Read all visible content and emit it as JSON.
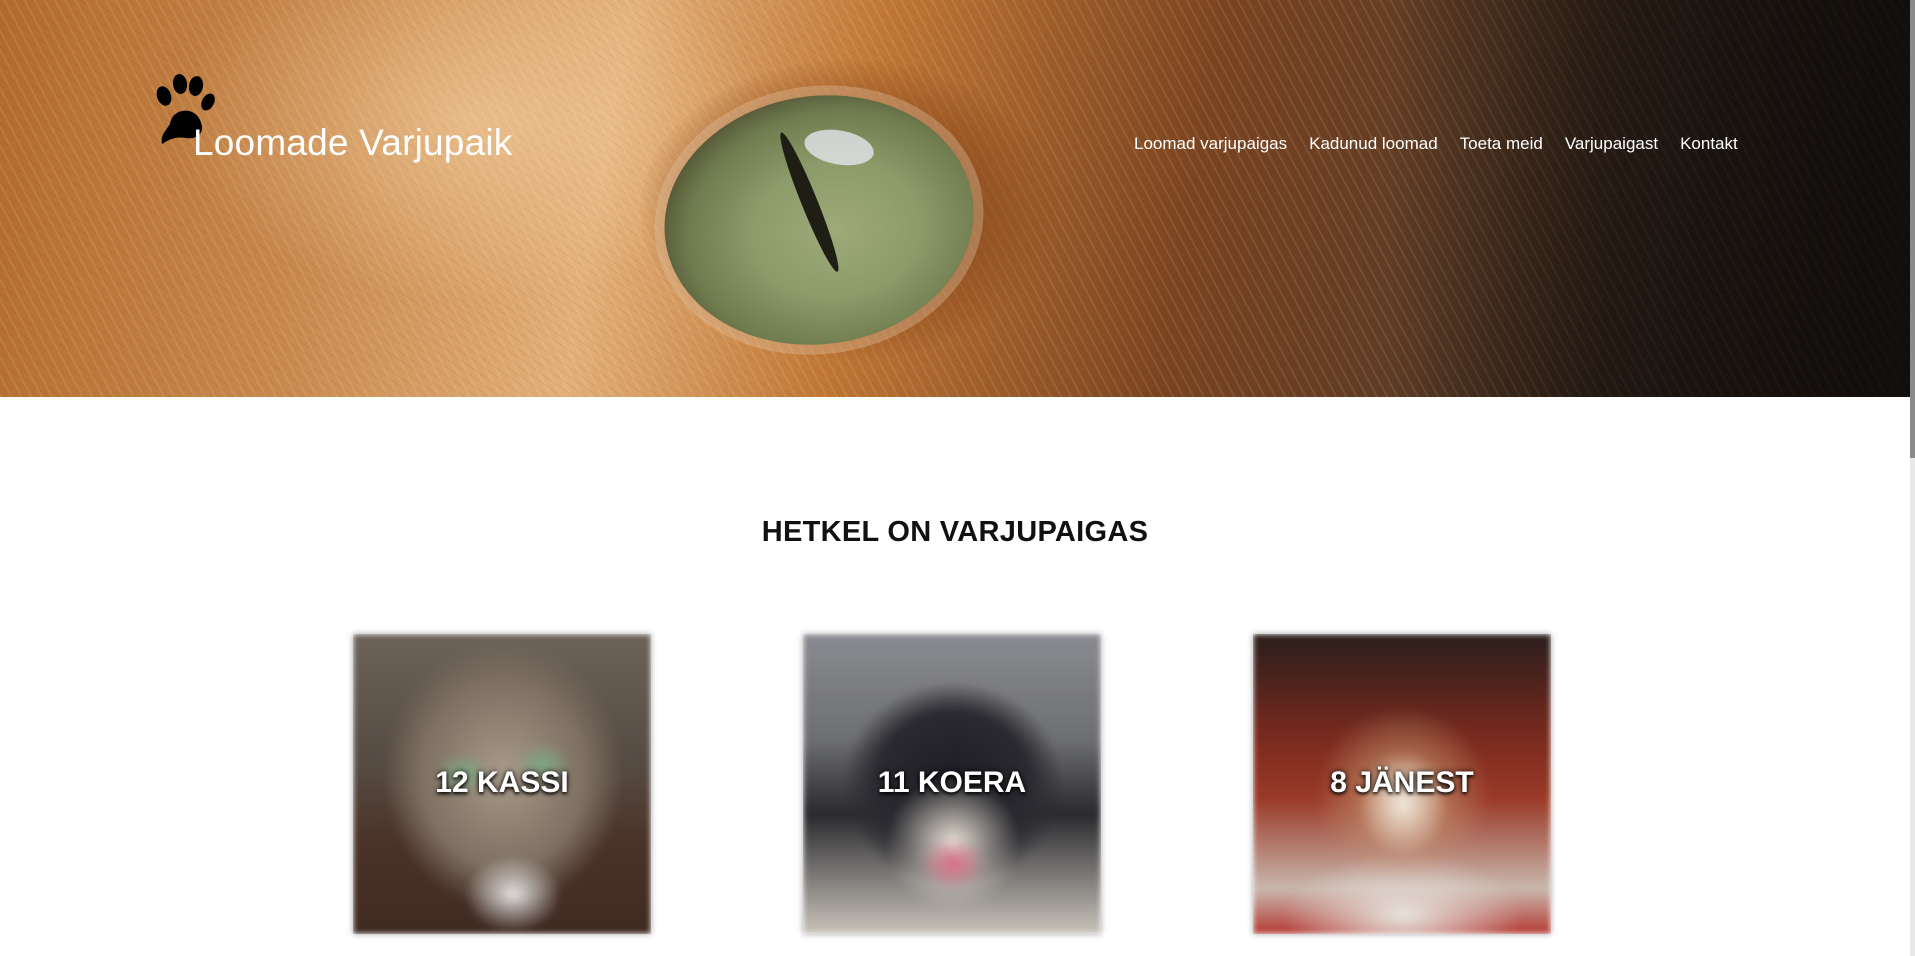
{
  "site": {
    "brand": "Loomade Varjupaik",
    "logo_icon": "paw-icon"
  },
  "nav": {
    "items": [
      {
        "label": "Loomad varjupaigas"
      },
      {
        "label": "Kadunud loomad"
      },
      {
        "label": "Toeta meid"
      },
      {
        "label": "Varjupaigast"
      },
      {
        "label": "Kontakt"
      }
    ]
  },
  "main": {
    "section_title": "HETKEL ON VARJUPAIGAS",
    "cards": [
      {
        "label": "12 KASSI",
        "image": "cat-photo"
      },
      {
        "label": "11 KOERA",
        "image": "dog-photo"
      },
      {
        "label": "8 JÄNEST",
        "image": "rabbit-photo"
      }
    ]
  },
  "colors": {
    "nav_text": "#ffffff",
    "title_text": "#111111",
    "card_label": "#ffffff"
  }
}
